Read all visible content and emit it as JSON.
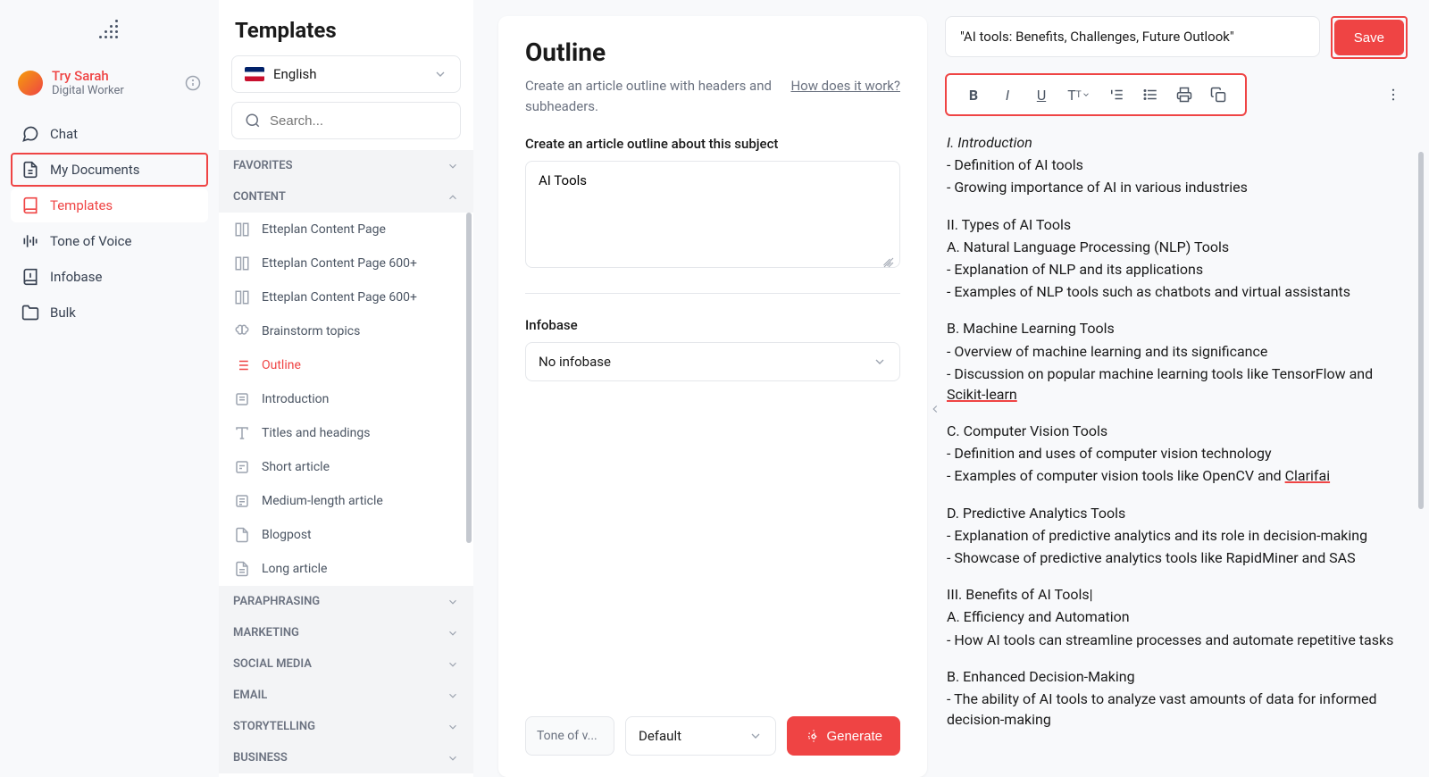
{
  "user": {
    "name": "Try Sarah",
    "role": "Digital Worker"
  },
  "nav": {
    "chat": "Chat",
    "my_documents": "My Documents",
    "templates": "Templates",
    "tone_of_voice": "Tone of Voice",
    "infobase": "Infobase",
    "bulk": "Bulk"
  },
  "templates_panel": {
    "header": "Templates",
    "language": "English",
    "search_placeholder": "Search...",
    "sections": {
      "favorites": "FAVORITES",
      "content": "CONTENT",
      "paraphrasing": "PARAPHRASING",
      "marketing": "MARKETING",
      "social_media": "SOCIAL MEDIA",
      "email": "EMAIL",
      "storytelling": "STORYTELLING",
      "business": "BUSINESS"
    },
    "content_items": [
      "Etteplan Content Page",
      "Etteplan Content Page 600+",
      "Etteplan Content Page 600+",
      "Brainstorm topics",
      "Outline",
      "Introduction",
      "Titles and headings",
      "Short article",
      "Medium-length article",
      "Blogpost",
      "Long article"
    ]
  },
  "center": {
    "title": "Outline",
    "description": "Create an article outline with headers and subheaders.",
    "how_link": "How does it work?",
    "field_label": "Create an article outline about this subject",
    "field_value": "AI Tools",
    "infobase_label": "Infobase",
    "infobase_value": "No infobase",
    "tone_label": "Tone of v...",
    "default_label": "Default",
    "generate": "Generate"
  },
  "right": {
    "doc_title": "\"AI tools: Benefits, Challenges, Future Outlook\"",
    "save": "Save",
    "content": {
      "s1_head": "I. Introduction",
      "s1_a": "- Definition of AI tools",
      "s1_b": "- Growing importance of AI in various industries",
      "s2_head": "II. Types of AI Tools",
      "s2a_head": "A. Natural Language Processing (NLP) Tools",
      "s2a_a": "- Explanation of NLP and its applications",
      "s2a_b": "- Examples of NLP tools such as chatbots and virtual assistants",
      "s2b_head": "B. Machine Learning Tools",
      "s2b_a": "- Overview of machine learning and its significance",
      "s2b_b_pre": "- Discussion on popular machine learning tools like TensorFlow and ",
      "s2b_b_u": "Scikit-learn",
      "s2c_head": "C. Computer Vision Tools",
      "s2c_a": "- Definition and uses of computer vision technology",
      "s2c_b_pre": "- Examples of computer vision tools like OpenCV and ",
      "s2c_b_u": "Clarifai",
      "s2d_head": "D. Predictive Analytics Tools",
      "s2d_a": "- Explanation of predictive analytics and its role in decision-making",
      "s2d_b": "- Showcase of predictive analytics tools like RapidMiner and SAS",
      "s3_head": "III. Benefits of AI Tools",
      "s3_cursor": "|",
      "s3a_head": "A. Efficiency and Automation",
      "s3a_a": "- How AI tools can streamline processes and automate repetitive tasks",
      "s3b_head": "B. Enhanced Decision-Making",
      "s3b_a": "- The ability of AI tools to analyze vast amounts of data for informed decision-making"
    }
  }
}
